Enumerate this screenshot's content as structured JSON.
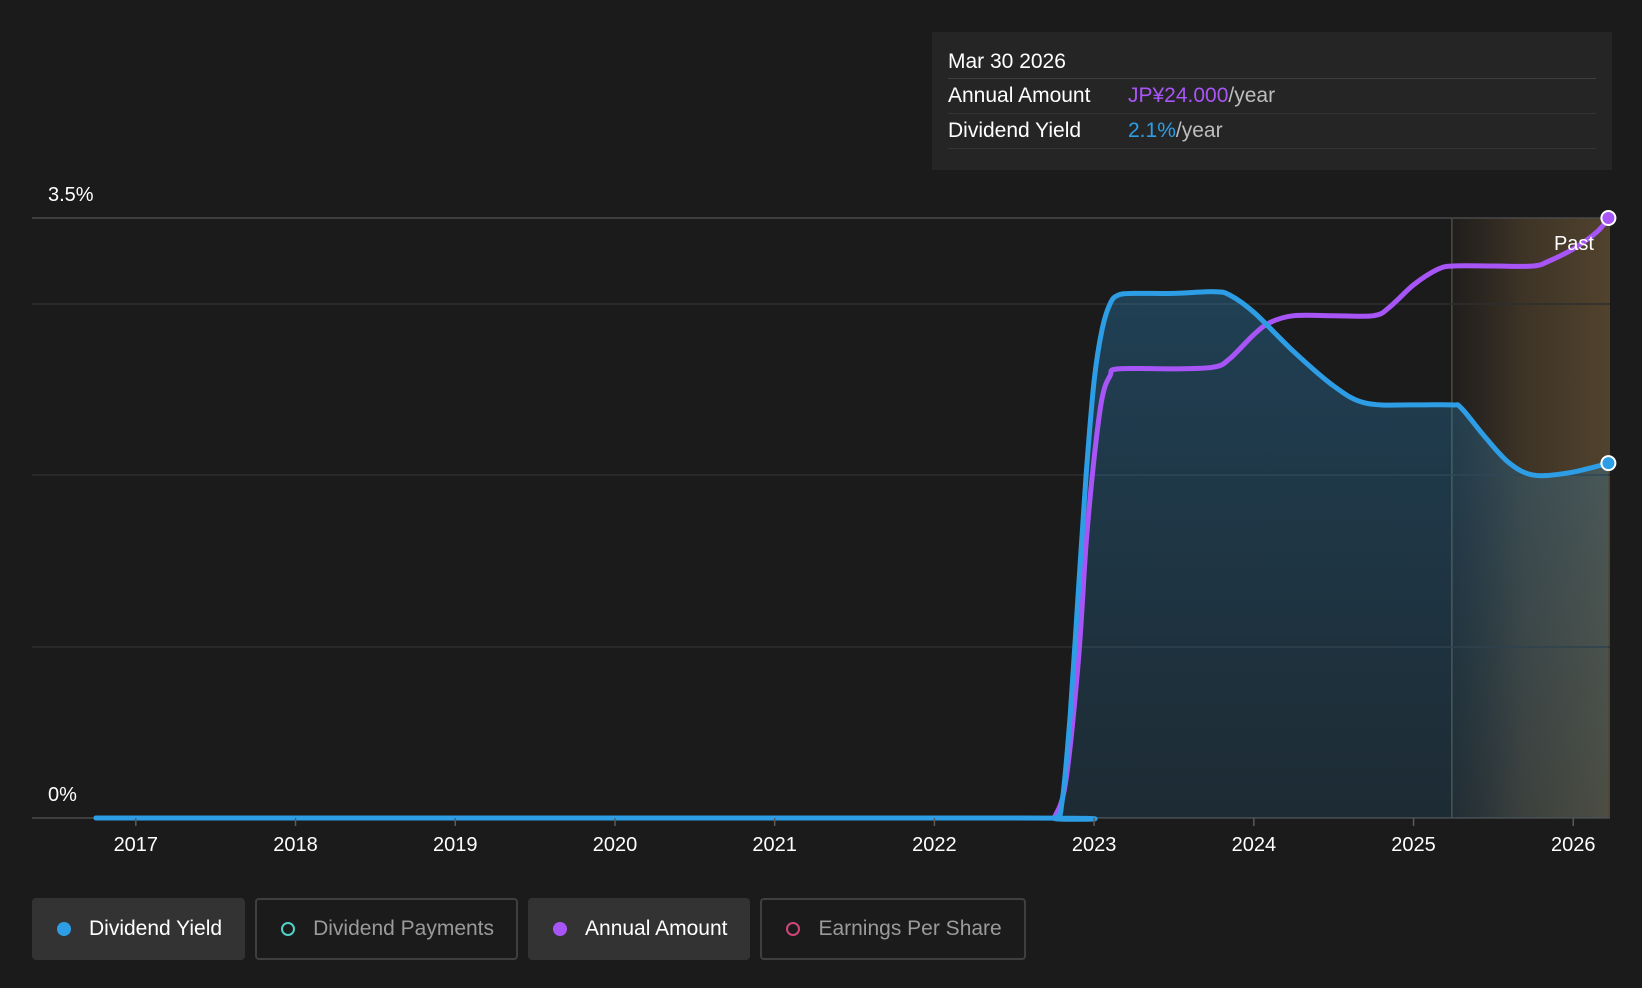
{
  "chart_data": {
    "type": "area",
    "x_ticks": [
      "2017",
      "2018",
      "2019",
      "2020",
      "2021",
      "2022",
      "2023",
      "2024",
      "2025",
      "2026"
    ],
    "y_labels": {
      "top": "3.5%",
      "bottom": "0%"
    },
    "ylim": [
      0,
      3.5
    ],
    "xlim": [
      2016.35,
      2026.23
    ],
    "grid": true,
    "past_label": "Past",
    "past_start": 2025.24,
    "series": [
      {
        "name": "Dividend Yield",
        "color": "#2d9ee6",
        "filled": true,
        "points": [
          [
            2016.75,
            0
          ],
          [
            2022.5,
            0
          ],
          [
            2022.75,
            0
          ],
          [
            2022.8,
            0.1
          ],
          [
            2022.85,
            0.6
          ],
          [
            2022.9,
            1.3
          ],
          [
            2022.95,
            2.0
          ],
          [
            2023.0,
            2.55
          ],
          [
            2023.05,
            2.85
          ],
          [
            2023.1,
            3.0
          ],
          [
            2023.15,
            3.05
          ],
          [
            2023.25,
            3.06
          ],
          [
            2023.5,
            3.06
          ],
          [
            2023.75,
            3.07
          ],
          [
            2023.85,
            3.05
          ],
          [
            2024.0,
            2.95
          ],
          [
            2024.25,
            2.72
          ],
          [
            2024.5,
            2.52
          ],
          [
            2024.7,
            2.42
          ],
          [
            2025.0,
            2.41
          ],
          [
            2025.24,
            2.41
          ],
          [
            2025.3,
            2.39
          ],
          [
            2025.45,
            2.22
          ],
          [
            2025.6,
            2.07
          ],
          [
            2025.75,
            2.0
          ],
          [
            2025.95,
            2.01
          ],
          [
            2026.1,
            2.04
          ],
          [
            2026.22,
            2.07
          ]
        ]
      },
      {
        "name": "Annual Amount",
        "color": "#a855f7",
        "filled": false,
        "points": [
          [
            2022.75,
            0
          ],
          [
            2022.82,
            0.2
          ],
          [
            2022.9,
            0.9
          ],
          [
            2022.95,
            1.6
          ],
          [
            2023.0,
            2.1
          ],
          [
            2023.05,
            2.45
          ],
          [
            2023.1,
            2.58
          ],
          [
            2023.15,
            2.62
          ],
          [
            2023.5,
            2.62
          ],
          [
            2023.75,
            2.63
          ],
          [
            2023.85,
            2.68
          ],
          [
            2024.0,
            2.82
          ],
          [
            2024.1,
            2.89
          ],
          [
            2024.25,
            2.93
          ],
          [
            2024.5,
            2.93
          ],
          [
            2024.75,
            2.93
          ],
          [
            2024.85,
            2.98
          ],
          [
            2025.0,
            3.11
          ],
          [
            2025.15,
            3.2
          ],
          [
            2025.25,
            3.22
          ],
          [
            2025.5,
            3.22
          ],
          [
            2025.75,
            3.22
          ],
          [
            2025.85,
            3.25
          ],
          [
            2026.0,
            3.32
          ],
          [
            2026.15,
            3.42
          ],
          [
            2026.22,
            3.5
          ]
        ]
      }
    ],
    "tooltip": {
      "date": "Mar 30 2026",
      "rows": [
        {
          "label": "Annual Amount",
          "value": "JP¥24.000",
          "unit": "/year",
          "color": "#a855f7"
        },
        {
          "label": "Dividend Yield",
          "value": "2.1%",
          "unit": "/year",
          "color": "#2d9ee6"
        }
      ]
    }
  },
  "legend": [
    {
      "label": "Dividend Yield",
      "active": true,
      "color": "#2d9ee6",
      "filled": true
    },
    {
      "label": "Dividend Payments",
      "active": false,
      "color": "#4fd1c5",
      "filled": false
    },
    {
      "label": "Annual Amount",
      "active": true,
      "color": "#a855f7",
      "filled": true
    },
    {
      "label": "Earnings Per Share",
      "active": false,
      "color": "#d0457a",
      "filled": false
    }
  ]
}
